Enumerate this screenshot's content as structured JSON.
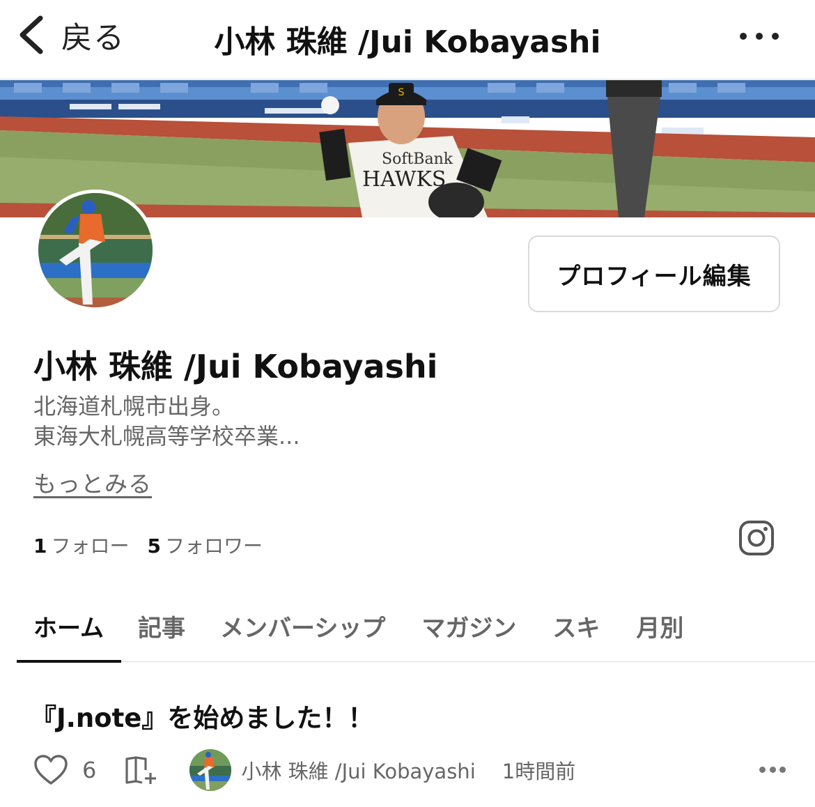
{
  "nav": {
    "back_label": "戻る",
    "title": "小林 珠維 /Jui Kobayashi"
  },
  "profile": {
    "edit_button": "プロフィール編集",
    "name": "小林 珠維 /Jui Kobayashi",
    "bio_line1": "北海道札幌市出身。",
    "bio_line2": "東海大札幌高等学校卒業...",
    "more_link": "もっとみる",
    "following_count": "1",
    "following_label": "フォロー",
    "followers_count": "5",
    "followers_label": "フォロワー"
  },
  "tabs": [
    {
      "label": "ホーム",
      "active": true
    },
    {
      "label": "記事",
      "active": false
    },
    {
      "label": "メンバーシップ",
      "active": false
    },
    {
      "label": "マガジン",
      "active": false
    },
    {
      "label": "スキ",
      "active": false
    },
    {
      "label": "月別",
      "active": false
    }
  ],
  "article": {
    "title": "『J.note』を始めました！！",
    "like_count": "6",
    "author": "小林 珠維 /Jui Kobayashi",
    "time": "1時間前"
  },
  "colors": {
    "text_primary": "#111111",
    "text_secondary": "#666666",
    "border": "#dcdcdc"
  },
  "icons": {
    "back": "chevron-left-icon",
    "more": "more-dots-icon",
    "instagram": "instagram-icon",
    "like": "heart-icon",
    "magazine_add": "magazine-add-icon"
  }
}
